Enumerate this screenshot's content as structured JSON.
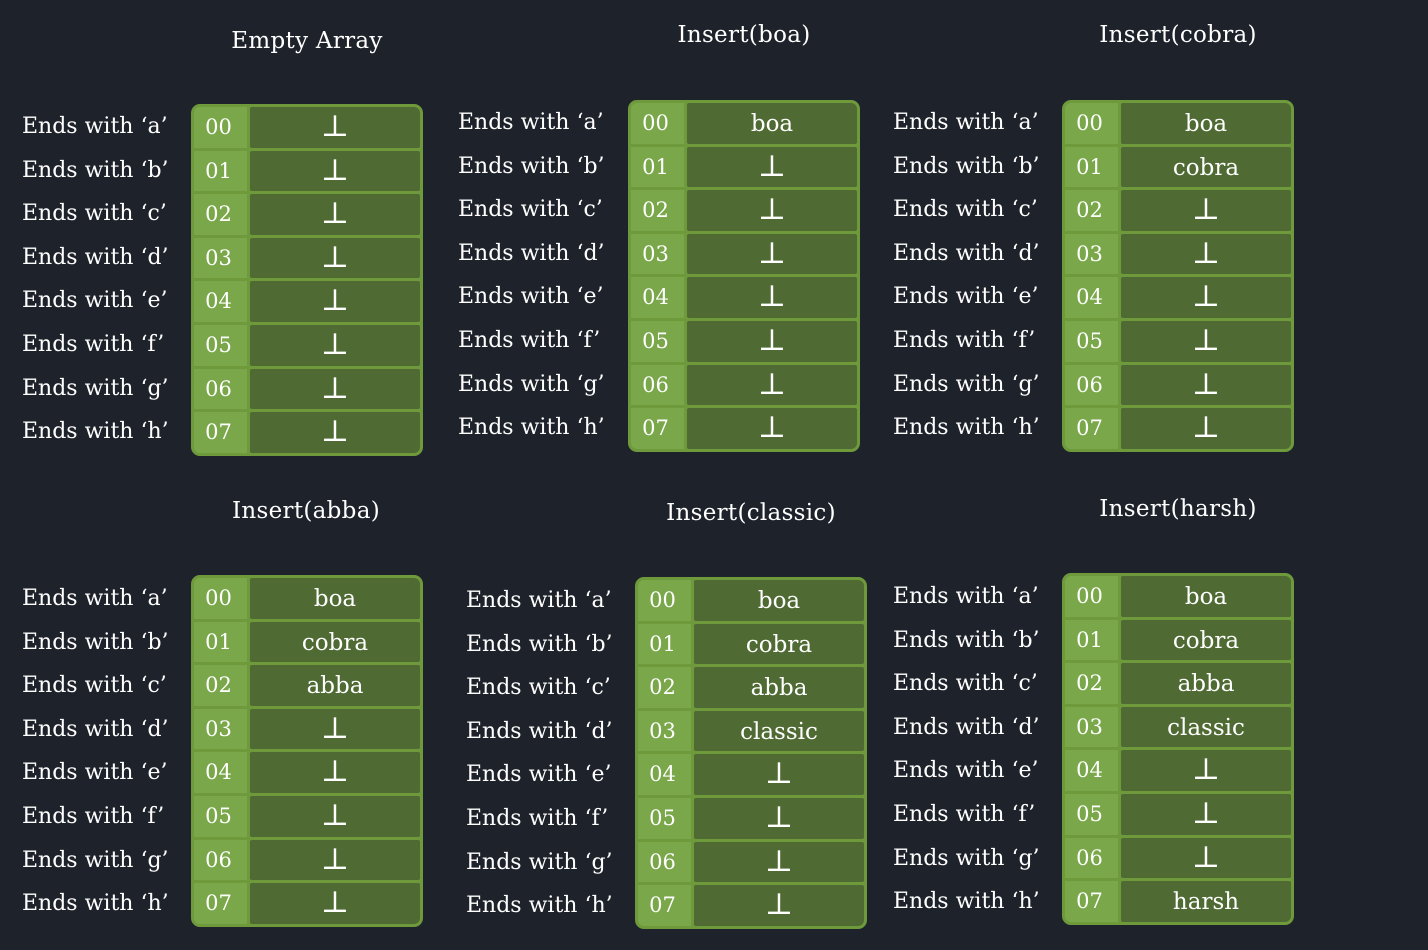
{
  "row_labels": [
    "Ends with ‘a’",
    "Ends with ‘b’",
    "Ends with ‘c’",
    "Ends with ‘d’",
    "Ends with ‘e’",
    "Ends with ‘f’",
    "Ends with ‘g’",
    "Ends with ‘h’"
  ],
  "indices": [
    "00",
    "01",
    "02",
    "03",
    "04",
    "05",
    "06",
    "07"
  ],
  "empty_symbol": "⊥",
  "colors": {
    "background": "#1e222a",
    "table_border": "#6f9a3c",
    "index_cell": "#7aa74a",
    "value_cell": "#4f6b33",
    "text": "#ffffff"
  },
  "panels": [
    {
      "title": "Empty Array",
      "values": [
        "⊥",
        "⊥",
        "⊥",
        "⊥",
        "⊥",
        "⊥",
        "⊥",
        "⊥"
      ]
    },
    {
      "title": "Insert(boa)",
      "values": [
        "boa",
        "⊥",
        "⊥",
        "⊥",
        "⊥",
        "⊥",
        "⊥",
        "⊥"
      ]
    },
    {
      "title": "Insert(cobra)",
      "values": [
        "boa",
        "cobra",
        "⊥",
        "⊥",
        "⊥",
        "⊥",
        "⊥",
        "⊥"
      ]
    },
    {
      "title": "Insert(abba)",
      "values": [
        "boa",
        "cobra",
        "abba",
        "⊥",
        "⊥",
        "⊥",
        "⊥",
        "⊥"
      ]
    },
    {
      "title": "Insert(classic)",
      "values": [
        "boa",
        "cobra",
        "abba",
        "classic",
        "⊥",
        "⊥",
        "⊥",
        "⊥"
      ]
    },
    {
      "title": "Insert(harsh)",
      "values": [
        "boa",
        "cobra",
        "abba",
        "classic",
        "⊥",
        "⊥",
        "⊥",
        "harsh"
      ]
    }
  ]
}
